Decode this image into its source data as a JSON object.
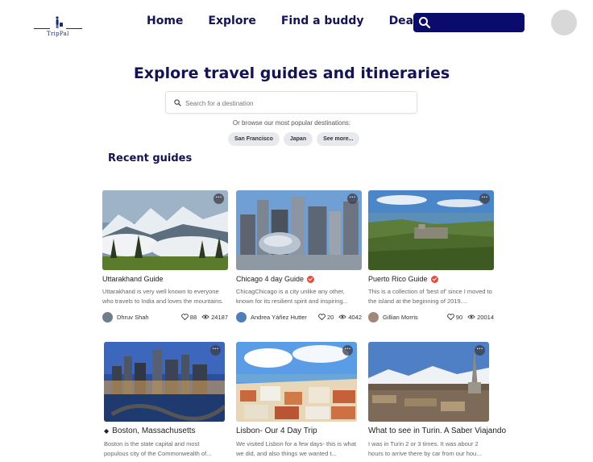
{
  "brand": {
    "logo_text": "TripPal"
  },
  "nav": {
    "items": [
      "Home",
      "Explore",
      "Find a buddy",
      "Deals"
    ]
  },
  "hero": {
    "title": "Explore travel guides and itineraries",
    "search_placeholder": "Search for a destination",
    "browse_text": "Or browse our most popular destinations:",
    "chips": [
      "San Francisco",
      "Japan",
      "See more..."
    ]
  },
  "section": {
    "title": "Recent guides"
  },
  "guides": [
    {
      "title": "Uttarakhand Guide",
      "verified": false,
      "desc": "Uttarakhand is very well known to everyone who travels to India and loves the mountains.",
      "author": "Dhruv Shah",
      "likes": "88",
      "views": "24187"
    },
    {
      "title": "Chicago 4 day Guide",
      "verified": true,
      "desc": "ChicagChicago is a city unlike any other, known for its resilient spirit and inspiring...",
      "author": "Andrea Yáñez Hutter",
      "likes": "20",
      "views": "4042"
    },
    {
      "title": "Puerto Rico Guide",
      "verified": true,
      "desc": "This is a collection of 'best of' since I moved to the island at the beginning of 2019....",
      "author": "Gillian Morris",
      "likes": "90",
      "views": "20014"
    },
    {
      "title": "Boston, Massachusetts",
      "verified": false,
      "desc": "Boston is the state capital and most populous city of the Commonwealth of...",
      "author": "",
      "likes": "",
      "views": ""
    },
    {
      "title": "Lisbon- Our 4 Day Trip",
      "verified": false,
      "desc": "We visited Lisbon for a few days- this is what we did, and also things we wanted t...",
      "author": "",
      "likes": "",
      "views": ""
    },
    {
      "title": "What to see in Turin. A Saber Viajando",
      "verified": false,
      "desc": "I was in Turin 2 or 3 times. It was abour 2 hours to arrive there by car from our hou...",
      "author": "",
      "likes": "",
      "views": ""
    }
  ],
  "colors": {
    "navy": "#141452",
    "search_bg": "#0b0b6e",
    "verified": "#e74c3c"
  }
}
